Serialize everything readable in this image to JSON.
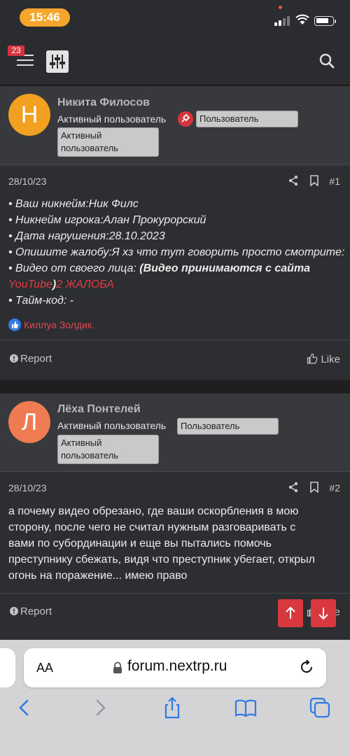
{
  "status_bar": {
    "time": "15:46"
  },
  "navbar": {
    "notification_count": "23"
  },
  "posts": [
    {
      "avatar_letter": "Н",
      "avatar_color": "#f1a020",
      "username": "Никита Филосов",
      "user_title": "Активный пользователь",
      "banner_user": "Пользователь",
      "banner_active": "Активный пользователь",
      "date": "28/10/23",
      "number": "#1",
      "lines": {
        "nickname": "• Ваш никнейм:Ник Филс",
        "player_nick": "• Никнейм игрока:Алан Прокурорский",
        "date": "• Дата нарушения:28.10.2023",
        "complaint": "• Опишите жалобу:Я хз что тут говорить просто смотрите:",
        "video_prefix": "• Видео от своего лица: ",
        "video_bold": "(Видео принимаются с сайта",
        "youtube": "YouTube",
        "close_paren": ")",
        "complaint_link": "2 ЖАЛОБА",
        "timecode": "• Тайм-код: -"
      },
      "reaction_user": "Киллуа Золдик.",
      "report_label": "Report",
      "like_label": "Like"
    },
    {
      "avatar_letter": "Л",
      "avatar_color": "#ee7b52",
      "username": "Лёха Понтелей",
      "user_title": "Активный пользователь",
      "banner_user": "Пользователь",
      "banner_active": "Активный пользователь",
      "date": "28/10/23",
      "number": "#2",
      "lines": [
        "а почему видео обрезано, где ваши оскорбления в мою",
        "сторону, после чего не считал нужным разговаривать с",
        "вами по субординации и еще вы пытались помочь",
        "преступнику сбежать, видя что преступник убегает, открыл",
        "огонь на поражение... имею право"
      ],
      "report_label": "Report",
      "like_label": "Like"
    }
  ],
  "browser": {
    "text_size_label": "AA",
    "url": "forum.nextrp.ru"
  },
  "colors": {
    "accent_red": "#d9383f",
    "banner_bg": "#c9c9c9"
  }
}
